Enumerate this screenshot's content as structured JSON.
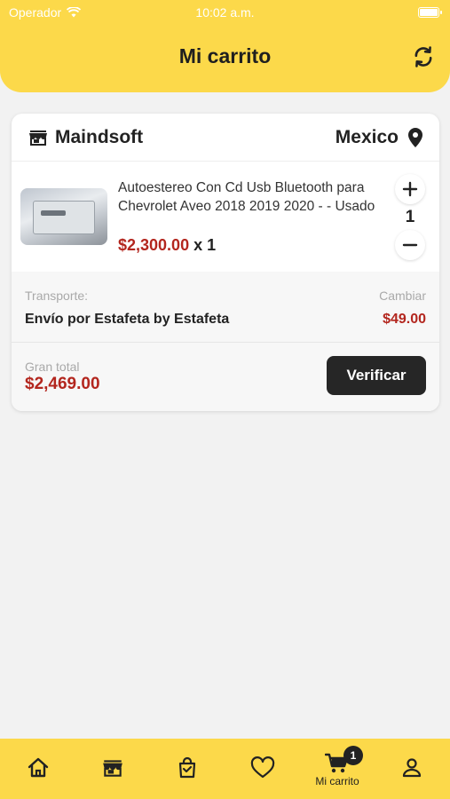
{
  "status_bar": {
    "carrier": "Operador",
    "time": "10:02 a.m."
  },
  "header": {
    "title": "Mi carrito"
  },
  "store": {
    "name": "Maindsoft",
    "location": "Mexico"
  },
  "item": {
    "title": "Autoestereo Con Cd Usb Bluetooth para Chevrolet Aveo 2018 2019 2020 - - Usado",
    "price": "$2,300.00",
    "qty_suffix": "x 1",
    "quantity": "1"
  },
  "shipping": {
    "label": "Transporte:",
    "change_label": "Cambiar",
    "method": "Envío por Estafeta by Estafeta",
    "price": "$49.00"
  },
  "total": {
    "label": "Gran total",
    "value": "$2,469.00",
    "checkout_label": "Verificar"
  },
  "tabbar": {
    "items": [
      {
        "icon": "home-icon"
      },
      {
        "icon": "store-icon"
      },
      {
        "icon": "shopping-bag-icon"
      },
      {
        "icon": "heart-icon"
      },
      {
        "icon": "cart-icon",
        "label": "Mi carrito",
        "badge": "1",
        "active": true
      },
      {
        "icon": "user-icon"
      }
    ]
  },
  "colors": {
    "brand_yellow": "#fcd94a",
    "price_red": "#b3261e",
    "dark_button": "#262626"
  }
}
